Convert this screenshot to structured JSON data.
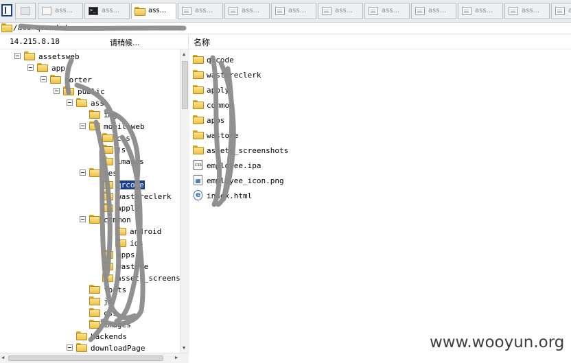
{
  "tabs": [
    {
      "label": "ass...",
      "icon": "file-icon"
    },
    {
      "label": "ass...",
      "icon": "terminal-icon"
    },
    {
      "label": "ass...",
      "icon": "folder-icon",
      "active": true
    },
    {
      "label": "ass...",
      "icon": "page-icon"
    },
    {
      "label": "ass...",
      "icon": "page-icon"
    },
    {
      "label": "ass...",
      "icon": "page-icon"
    },
    {
      "label": "ass...",
      "icon": "page-icon"
    },
    {
      "label": "ass...",
      "icon": "page-icon"
    },
    {
      "label": "ass...",
      "icon": "page-icon"
    },
    {
      "label": "ass...",
      "icon": "page-icon"
    },
    {
      "label": "ass...",
      "icon": "page-icon"
    },
    {
      "label": "ass...",
      "icon": "page-icon"
    }
  ],
  "path": {
    "text": "/ass                                  qrcode/"
  },
  "header": {
    "ip": "14.215.8.18",
    "loading": "请稍候...",
    "name_column": "名称"
  },
  "tree": [
    {
      "label": "assetsweb",
      "depth": 1,
      "expanded": true
    },
    {
      "label": "app",
      "depth": 2,
      "expanded": true
    },
    {
      "label": "porter",
      "depth": 3,
      "expanded": true
    },
    {
      "label": "public",
      "depth": 4,
      "expanded": true
    },
    {
      "label": "ass",
      "depth": 5,
      "expanded": true
    },
    {
      "label": "img",
      "depth": 6
    },
    {
      "label": "mobileweb",
      "depth": 6,
      "expanded": true
    },
    {
      "label": "css",
      "depth": 7
    },
    {
      "label": "js",
      "depth": 7
    },
    {
      "label": "images",
      "depth": 7
    },
    {
      "label": "tes",
      "depth": 6,
      "expanded": true
    },
    {
      "label": "qrcode",
      "depth": 7,
      "selected": true
    },
    {
      "label": "wastereclerk",
      "depth": 7
    },
    {
      "label": "apply",
      "depth": 7
    },
    {
      "label": "common",
      "depth": 6,
      "expanded": true,
      "shift": true
    },
    {
      "label": "android",
      "depth": 8
    },
    {
      "label": "ios",
      "depth": 8
    },
    {
      "label": "apps",
      "depth": 7
    },
    {
      "label": "wastore",
      "depth": 7
    },
    {
      "label": "assets_screenshots",
      "depth": 7
    },
    {
      "label": "fonts",
      "depth": 6
    },
    {
      "label": "js",
      "depth": 6
    },
    {
      "label": "css",
      "depth": 6
    },
    {
      "label": "images",
      "depth": 6
    },
    {
      "label": "backends",
      "depth": 5
    },
    {
      "label": "downloadPage",
      "depth": 5,
      "expanded": true
    }
  ],
  "files": [
    {
      "name": "qrcode",
      "type": "folder"
    },
    {
      "name": "wastereclerk",
      "type": "folder"
    },
    {
      "name": "apply",
      "type": "folder"
    },
    {
      "name": "common",
      "type": "folder"
    },
    {
      "name": "apps",
      "type": "folder"
    },
    {
      "name": "wastore",
      "type": "folder"
    },
    {
      "name": "assets_screenshots",
      "type": "folder"
    },
    {
      "name": "employee.ipa",
      "type": "ipa"
    },
    {
      "name": "employee_icon.png",
      "type": "png"
    },
    {
      "name": "index.html",
      "type": "html"
    }
  ],
  "watermark": "www.wooyun.org",
  "colors": {
    "selection": "#1c3f8c",
    "folder": "#eec24a",
    "scribble": "#8c8c8c"
  }
}
